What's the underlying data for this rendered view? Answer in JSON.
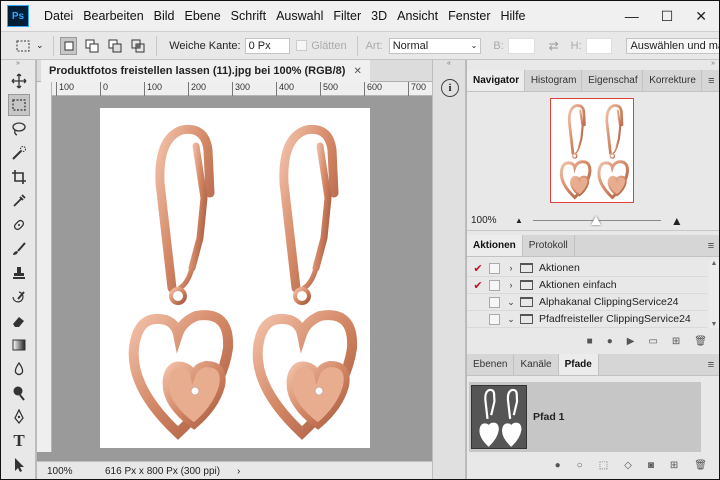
{
  "app": {
    "logo": "Ps"
  },
  "menubar": [
    "Datei",
    "Bearbeiten",
    "Bild",
    "Ebene",
    "Schrift",
    "Auswahl",
    "Filter",
    "3D",
    "Ansicht",
    "Fenster",
    "Hilfe"
  ],
  "window_controls": {
    "minimize": "—",
    "maximize": "☐",
    "close": "✕"
  },
  "options": {
    "feather_label": "Weiche Kante:",
    "feather_value": "0 Px",
    "antialias_label": "Glätten",
    "style_label": "Art:",
    "style_value": "Normal",
    "width_label": "B:",
    "height_label": "H:",
    "select_mask_label": "Auswählen und mask"
  },
  "document": {
    "tab_title": "Produktfotos freistellen lassen (11).jpg bei 100% (RGB/8)",
    "tab_close": "✕",
    "ruler_labels": [
      "100",
      "0",
      "100",
      "200",
      "300",
      "400",
      "500",
      "600",
      "700"
    ],
    "zoom": "100%",
    "doc_info": "616 Px x 800 Px (300 ppi)",
    "status_arrow": "›"
  },
  "navigator_panel": {
    "tabs": [
      "Navigator",
      "Histogram",
      "Eigenschaf",
      "Korrekture"
    ],
    "zoom": "100%",
    "menu_icon": "≡"
  },
  "actions_panel": {
    "tabs": [
      "Aktionen",
      "Protokoll"
    ],
    "rows": [
      {
        "label": "Aktionen",
        "checked": true
      },
      {
        "label": "Aktionen einfach",
        "checked": true
      },
      {
        "label": "Alphakanal ClippingService24",
        "checked": false
      },
      {
        "label": "Pfadfreisteller ClippingService24",
        "checked": false
      }
    ]
  },
  "paths_panel": {
    "tabs": [
      "Ebenen",
      "Kanäle",
      "Pfade"
    ],
    "path_name": "Pfad 1"
  },
  "colors": {
    "accent_red": "#c0121f",
    "navigator_frame": "#e0413b",
    "rose_gold": "#d58c6f",
    "selection_bg": "#c6c6c6"
  }
}
